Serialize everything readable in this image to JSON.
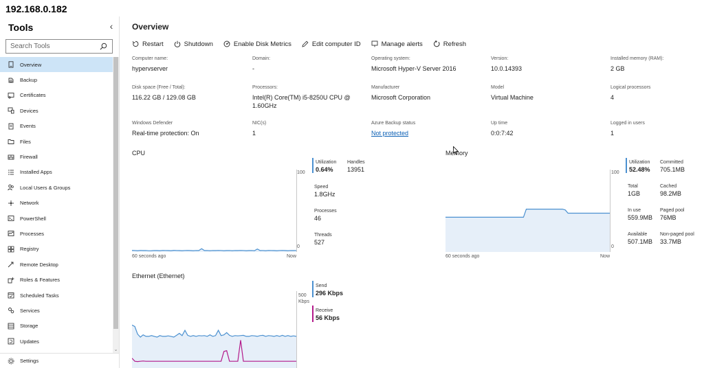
{
  "app": {
    "title": "192.168.0.182"
  },
  "sidebar": {
    "heading": "Tools",
    "search_placeholder": "Search Tools",
    "items": [
      {
        "label": "Overview",
        "icon": "computer-icon",
        "active": true
      },
      {
        "label": "Backup",
        "icon": "backup-icon"
      },
      {
        "label": "Certificates",
        "icon": "certificate-icon"
      },
      {
        "label": "Devices",
        "icon": "devices-icon"
      },
      {
        "label": "Events",
        "icon": "events-icon"
      },
      {
        "label": "Files",
        "icon": "folder-icon"
      },
      {
        "label": "Firewall",
        "icon": "firewall-icon"
      },
      {
        "label": "Installed Apps",
        "icon": "apps-list-icon"
      },
      {
        "label": "Local Users & Groups",
        "icon": "users-icon"
      },
      {
        "label": "Network",
        "icon": "network-icon"
      },
      {
        "label": "PowerShell",
        "icon": "powershell-icon"
      },
      {
        "label": "Processes",
        "icon": "processes-icon"
      },
      {
        "label": "Registry",
        "icon": "registry-icon"
      },
      {
        "label": "Remote Desktop",
        "icon": "remote-desktop-icon"
      },
      {
        "label": "Roles & Features",
        "icon": "roles-icon"
      },
      {
        "label": "Scheduled Tasks",
        "icon": "scheduled-tasks-icon"
      },
      {
        "label": "Services",
        "icon": "services-icon"
      },
      {
        "label": "Storage",
        "icon": "storage-icon"
      },
      {
        "label": "Updates",
        "icon": "updates-icon"
      }
    ],
    "settings_label": "Settings"
  },
  "main": {
    "title": "Overview",
    "toolbar": {
      "restart": "Restart",
      "shutdown": "Shutdown",
      "disk_metrics": "Enable Disk Metrics",
      "edit_id": "Edit computer ID",
      "alerts": "Manage alerts",
      "refresh": "Refresh"
    },
    "props": [
      {
        "label": "Computer name:",
        "value": "hypervserver"
      },
      {
        "label": "Domain:",
        "value": "-"
      },
      {
        "label": "Operating system:",
        "value": "Microsoft Hyper-V Server 2016"
      },
      {
        "label": "Version:",
        "value": "10.0.14393"
      },
      {
        "label": "Installed memory (RAM):",
        "value": "2 GB"
      },
      {
        "label": "Disk space (Free / Total):",
        "value": "116.22 GB / 129.08 GB"
      },
      {
        "label": "Processors:",
        "value": "Intel(R) Core(TM) i5-8250U CPU @ 1.60GHz"
      },
      {
        "label": "Manufacturer",
        "value": "Microsoft Corporation"
      },
      {
        "label": "Model",
        "value": "Virtual Machine"
      },
      {
        "label": "Logical processors",
        "value": "4"
      },
      {
        "label": "Windows Defender",
        "value": "Real-time protection: On"
      },
      {
        "label": "NIC(s)",
        "value": "1"
      },
      {
        "label": "Azure Backup status",
        "value": "Not protected",
        "link": true
      },
      {
        "label": "Up time",
        "value": "0:0:7:42"
      },
      {
        "label": "Logged in users",
        "value": "1"
      }
    ],
    "cpu": {
      "title": "CPU",
      "axis_max": "100",
      "axis_min": "0",
      "time_start": "60 seconds ago",
      "time_end": "Now",
      "utilization_label": "Utilization",
      "utilization": "0.64%",
      "handles_label": "Handles",
      "handles": "13951",
      "speed_label": "Speed",
      "speed": "1.8GHz",
      "processes_label": "Processes",
      "processes": "46",
      "threads_label": "Threads",
      "threads": "527",
      "series_values": [
        1.2,
        1.0,
        0.8,
        1.1,
        0.9,
        1.0,
        0.7,
        0.8,
        1.0,
        0.9,
        0.8,
        1.1,
        1.0,
        0.9,
        0.8,
        1.2,
        1.0,
        0.9,
        0.8,
        1.0,
        1.1,
        0.9,
        0.8,
        1.0,
        0.9,
        3.2,
        0.9,
        1.0,
        0.8,
        1.0,
        0.9,
        1.1,
        1.0,
        0.8,
        0.9,
        1.0,
        0.8,
        1.0,
        0.9,
        1.1,
        1.0,
        0.8,
        0.9,
        1.0,
        0.8,
        2.8,
        0.9,
        1.0,
        0.8,
        1.1,
        1.0,
        0.9,
        0.8,
        1.0,
        1.1,
        0.9,
        0.8,
        1.0,
        0.9,
        1.0
      ]
    },
    "memory": {
      "title": "Memory",
      "axis_max": "100",
      "axis_min": "0",
      "time_start": "60 seconds ago",
      "time_end": "Now",
      "utilization_label": "Utilization",
      "utilization": "52.48%",
      "committed_label": "Committed",
      "committed": "705.1MB",
      "total_label": "Total",
      "total": "1GB",
      "cached_label": "Cached",
      "cached": "98.2MB",
      "inuse_label": "In use",
      "inuse": "559.9MB",
      "paged_label": "Paged pool",
      "paged": "76MB",
      "available_label": "Available",
      "available": "507.1MB",
      "nonpaged_label": "Non-paged pool",
      "nonpaged": "33.7MB",
      "series_values": [
        42,
        42,
        42,
        42,
        42,
        42,
        42,
        42,
        42,
        42,
        42,
        42,
        42,
        42,
        42,
        42,
        42,
        42,
        42,
        42,
        42,
        42,
        42,
        42,
        42,
        42,
        42,
        42,
        42,
        52,
        52,
        52,
        52,
        52,
        52,
        52,
        52,
        52,
        52,
        52,
        52,
        52,
        52,
        51,
        47,
        47,
        47,
        47,
        47,
        47,
        47,
        47,
        47,
        47,
        47,
        47,
        47,
        47,
        47,
        47
      ]
    },
    "ethernet": {
      "title": "Ethernet (Ethernet)",
      "axis_max": "500",
      "axis_unit": "Kbps",
      "send_label": "Send",
      "send": "296 Kbps",
      "receive_label": "Receive",
      "receive": "56 Kbps",
      "send_values": [
        280,
        270,
        220,
        200,
        215,
        205,
        205,
        210,
        205,
        200,
        210,
        205,
        205,
        208,
        205,
        200,
        212,
        225,
        210,
        245,
        212,
        205,
        210,
        205,
        210,
        208,
        210,
        205,
        215,
        205,
        210,
        245,
        210,
        215,
        230,
        212,
        205,
        210,
        208,
        210,
        212,
        205,
        205,
        210,
        208,
        205,
        210,
        212,
        205,
        210,
        208,
        205,
        210,
        205,
        212,
        205,
        210,
        205,
        208,
        205
      ],
      "receive_values": [
        60,
        40,
        38,
        40,
        42,
        40,
        40,
        40,
        40,
        40,
        40,
        40,
        40,
        40,
        40,
        40,
        40,
        40,
        40,
        40,
        40,
        40,
        40,
        40,
        40,
        40,
        40,
        40,
        40,
        40,
        40,
        40,
        40,
        105,
        110,
        40,
        40,
        40,
        40,
        180,
        40,
        40,
        40,
        40,
        40,
        40,
        40,
        40,
        40,
        40,
        40,
        40,
        40,
        40,
        40,
        40,
        40,
        40,
        40,
        40
      ]
    }
  },
  "colors": {
    "cpu_line": "#4a90d0",
    "area_fill": "#e6eff9",
    "receive_line": "#b3198a",
    "active_nav": "#cde4f7"
  }
}
